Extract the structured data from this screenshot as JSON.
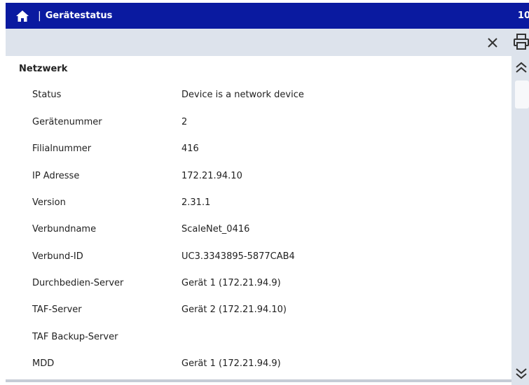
{
  "header": {
    "title": "Gerätestatus",
    "separator": "|",
    "right_text": "10",
    "home_icon": "home-icon",
    "bg_color": "#0a1aa0"
  },
  "toolbar": {
    "close_icon": "close-icon",
    "print_icon": "print-icon",
    "bg_color": "#dde3ec"
  },
  "section": {
    "title": "Netzwerk",
    "rows": [
      {
        "label": "Status",
        "value": "Device is a network device"
      },
      {
        "label": "Gerätenummer",
        "value": "2"
      },
      {
        "label": "Filialnummer",
        "value": "416"
      },
      {
        "label": "IP Adresse",
        "value": "172.21.94.10"
      },
      {
        "label": "Version",
        "value": "2.31.1"
      },
      {
        "label": "Verbundname",
        "value": "ScaleNet_0416"
      },
      {
        "label": "Verbund-ID",
        "value": "UC3.3343895-5877CAB4"
      },
      {
        "label": "Durchbedien-Server",
        "value": "Gerät 1 (172.21.94.9)"
      },
      {
        "label": "TAF-Server",
        "value": "Gerät 2 (172.21.94.10)"
      },
      {
        "label": "TAF Backup-Server",
        "value": ""
      },
      {
        "label": "MDD",
        "value": "Gerät 1 (172.21.94.9)"
      }
    ]
  },
  "scrollbar": {
    "up_icon": "double-chevron-up-icon",
    "down_icon": "double-chevron-down-icon"
  }
}
